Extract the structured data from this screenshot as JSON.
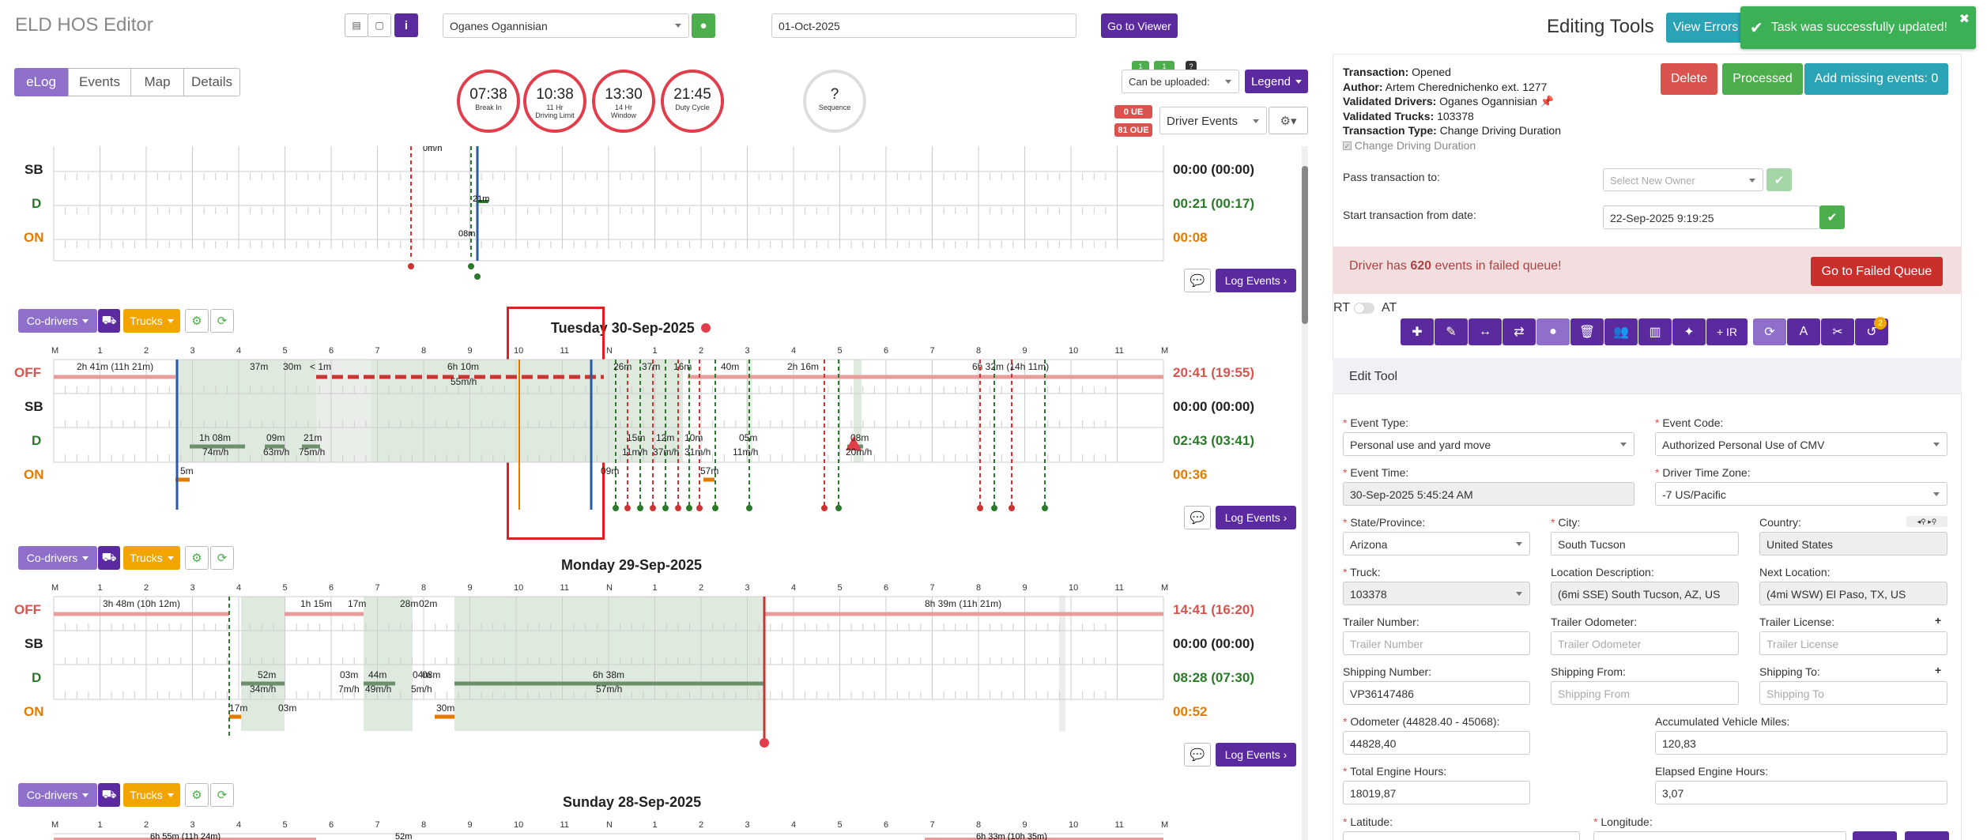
{
  "app": {
    "title": "ELD HOS Editor",
    "driver_select": "Oganes Ogannisian",
    "date": "01-Oct-2025",
    "go_to_viewer": "Go to Viewer"
  },
  "tabs": [
    "eLog",
    "Events",
    "Map",
    "Details"
  ],
  "gauges": [
    {
      "value": "07:38",
      "label1": "Break In",
      "label2": ""
    },
    {
      "value": "10:38",
      "label1": "11 Hr",
      "label2": "Driving Limit"
    },
    {
      "value": "13:30",
      "label1": "14 Hr",
      "label2": "Window"
    },
    {
      "value": "21:45",
      "label1": "Duty Cycle",
      "label2": ""
    },
    {
      "value": "?",
      "label1": "Sequence",
      "label2": ""
    }
  ],
  "badges": {
    "ue": "0 UE",
    "oue": "81 OUE",
    "upload_count1": "1",
    "upload_count2": "1",
    "question": "?"
  },
  "controls": {
    "can_be_uploaded": "Can be uploaded:",
    "legend": "Legend",
    "driver_events": "Driver Events",
    "co_drivers": "Co-drivers",
    "trucks": "Trucks",
    "log_events": "Log Events"
  },
  "rows": {
    "off": "OFF",
    "sb": "SB",
    "d": "D",
    "on": "ON"
  },
  "hours": [
    "M",
    "1",
    "2",
    "3",
    "4",
    "5",
    "6",
    "7",
    "8",
    "9",
    "10",
    "11",
    "N",
    "1",
    "2",
    "3",
    "4",
    "5",
    "6",
    "7",
    "8",
    "9",
    "10",
    "11",
    "M"
  ],
  "day0": {
    "totals": {
      "sb": "00:00 (00:00)",
      "d": "00:21 (00:17)",
      "on": "00:08"
    },
    "labels": [
      "0m/h",
      "21m",
      "08m"
    ]
  },
  "day1": {
    "title": "Tuesday 30-Sep-2025",
    "totals": {
      "off": "20:41 (19:55)",
      "sb": "00:00 (00:00)",
      "d": "02:43 (03:41)",
      "on": "00:36"
    },
    "labels": [
      "2h 41m (11h 21m)",
      "37m",
      "30m",
      "< 1m",
      "6h 10m",
      "55m/h",
      "26m",
      "37m",
      "16m",
      "40m",
      "2h 16m",
      "6h 32m (14h 11m)",
      "1h 08m",
      "74m/h",
      "09m",
      "63m/h",
      "21m",
      "75m/h",
      "15m",
      "11m/h",
      "12m",
      "37m/h",
      "10m",
      "31m/h",
      "05m",
      "11m/h",
      "08m",
      "20m/h",
      "5m",
      "09m",
      "57m"
    ]
  },
  "day2": {
    "title": "Monday 29-Sep-2025",
    "totals": {
      "off": "14:41 (16:20)",
      "sb": "00:00 (00:00)",
      "d": "08:28 (07:30)",
      "on": "00:52"
    },
    "labels": [
      "3h 48m (10h 12m)",
      "1h 15m",
      "17m",
      "28m",
      "02m",
      "8h 39m (11h 21m)",
      "52m",
      "34m/h",
      "03m",
      "7m/h",
      "44m",
      "49m/h",
      "04m",
      "5m/h",
      "08m",
      "6h 38m",
      "57m/h",
      "17m",
      "03m",
      "30m"
    ]
  },
  "day3": {
    "title": "Sunday 28-Sep-2025",
    "labels": [
      "6h 55m (11h 24m)",
      "52m",
      "6h 33m (10h 35m)"
    ]
  },
  "right": {
    "editing_tools": "Editing Tools",
    "view_errors": "View Errors",
    "toast": "Task was successfully updated!",
    "info": [
      {
        "k": "Transaction:",
        "v": "Opened"
      },
      {
        "k": "Author:",
        "v": "Artem Cherednichenko ext. 1277"
      },
      {
        "k": "Validated Drivers:",
        "v": "Oganes Ogannisian"
      },
      {
        "k": "Validated Trucks:",
        "v": "103378"
      },
      {
        "k": "Transaction Type:",
        "v": "Change Driving Duration"
      }
    ],
    "checkbox_label": "Change Driving Duration",
    "delete": "Delete",
    "processed": "Processed",
    "add_missing": "Add missing events: 0",
    "pass_to": "Pass transaction to:",
    "owner_ph": "Select New Owner",
    "start_from": "Start transaction from date:",
    "start_date": "22-Sep-2025 9:19:25",
    "alert_pre": "Driver has ",
    "alert_count": "620",
    "alert_post": " events in failed queue!",
    "go_failed": "Go to Failed Queue",
    "rt": "RT",
    "at": "AT",
    "ir": "+ IR",
    "toolbar_badge": "2",
    "edit_tool": "Edit Tool",
    "event_type_l": "Event Type:",
    "event_type": "Personal use and yard move",
    "event_code_l": "Event Code:",
    "event_code": "Authorized Personal Use of CMV",
    "event_time_l": "Event Time:",
    "event_time": "30-Sep-2025 5:45:24 AM",
    "tz_l": "Driver Time Zone:",
    "tz": "-7 US/Pacific",
    "state_l": "State/Province:",
    "state": "Arizona",
    "city_l": "City:",
    "city": "South Tucson",
    "country_l": "Country:",
    "country": "United States",
    "truck_l": "Truck:",
    "truck": "103378",
    "locdesc_l": "Location Description:",
    "locdesc": "(6mi SSE) South Tucson, AZ, US",
    "nextloc_l": "Next Location:",
    "nextloc": "(4mi WSW) El Paso, TX, US",
    "trailer_num_l": "Trailer Number:",
    "trailer_num": "Trailer Number",
    "trailer_odo_l": "Trailer Odometer:",
    "trailer_odo": "Trailer Odometer",
    "trailer_lic_l": "Trailer License:",
    "trailer_lic": "Trailer License",
    "ship_num_l": "Shipping Number:",
    "ship_num": "VP36147486",
    "ship_from_l": "Shipping From:",
    "ship_from": "Shipping From",
    "ship_to_l": "Shipping To:",
    "ship_to": "Shipping To",
    "odo_l": "Odometer (44828.40 - 45068):",
    "odo": "44828,40",
    "acc_l": "Accumulated Vehicle Miles:",
    "acc": "120,83",
    "eng_l": "Total Engine Hours:",
    "eng": "18019,87",
    "el_l": "Elapsed Engine Hours:",
    "el": "3,07",
    "lat_l": "Latitude:",
    "lon_l": "Longitude:"
  }
}
